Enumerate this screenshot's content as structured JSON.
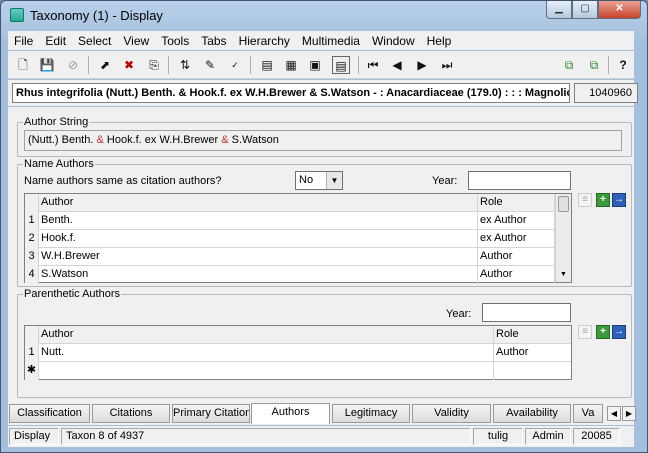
{
  "window": {
    "title": "Taxonomy (1) - Display"
  },
  "menu": [
    "File",
    "Edit",
    "Select",
    "View",
    "Tools",
    "Tabs",
    "Hierarchy",
    "Multimedia",
    "Window",
    "Help"
  ],
  "name_bar": {
    "full_name": "Rhus integrifolia (Nutt.) Benth. & Hook.f. ex W.H.Brewer & S.Watson -  : Anacardiaceae (179.0) : : : Magnoliopsida",
    "record_id": "1040960"
  },
  "author_string": {
    "label": "Author String",
    "parts": [
      "(Nutt.) Benth. ",
      "&",
      " Hook.f. ex W.H.Brewer ",
      "&",
      " S.Watson"
    ]
  },
  "name_authors": {
    "label": "Name Authors",
    "same_question": "Name authors same as citation authors?",
    "same_value": "No",
    "year_label": "Year:",
    "year_value": "",
    "columns": {
      "author": "Author",
      "role": "Role"
    },
    "rows": [
      {
        "num": "1",
        "author": "Benth.",
        "role": "ex Author"
      },
      {
        "num": "2",
        "author": "Hook.f.",
        "role": "ex Author"
      },
      {
        "num": "3",
        "author": "W.H.Brewer",
        "role": "Author"
      },
      {
        "num": "4",
        "author": "S.Watson",
        "role": "Author"
      }
    ]
  },
  "parenthetic_authors": {
    "label": "Parenthetic Authors",
    "year_label": "Year:",
    "year_value": "",
    "columns": {
      "author": "Author",
      "role": "Role"
    },
    "rows": [
      {
        "num": "1",
        "author": "Nutt.",
        "role": "Author"
      }
    ],
    "new_row_marker": "✱"
  },
  "tabs": [
    "Classification",
    "Citations",
    "Primary Citation",
    "Authors",
    "Legitimacy",
    "Validity",
    "Availability",
    "Va"
  ],
  "active_tab": "Authors",
  "status": {
    "mode": "Display",
    "record": "Taxon 8 of 4937",
    "user": "tulig",
    "role": "Admin",
    "number": "20085"
  }
}
